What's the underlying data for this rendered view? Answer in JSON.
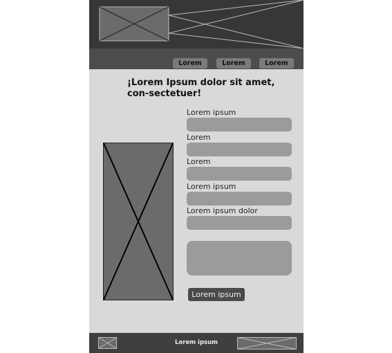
{
  "header": {
    "logo_icon": "image-placeholder-icon",
    "banner_icon": "image-placeholder-icon"
  },
  "nav": {
    "items": [
      {
        "label": "Lorem"
      },
      {
        "label": "Lorem"
      },
      {
        "label": "Lorem"
      }
    ]
  },
  "main": {
    "title": "¡Lorem Ipsum dolor sit amet, con-sectetuer!",
    "image_icon": "image-placeholder-icon",
    "form": {
      "fields": [
        {
          "label": "Lorem ipsum",
          "value": ""
        },
        {
          "label": "Lorem",
          "value": ""
        },
        {
          "label": "Lorem",
          "value": ""
        },
        {
          "label": "Lorem ipsum",
          "value": ""
        },
        {
          "label": "Lorem ipsum dolor",
          "value": ""
        }
      ],
      "message": "",
      "submit_label": "Lorem ipsum"
    }
  },
  "footer": {
    "text": "Lorem ipsum",
    "left_icon": "image-placeholder-icon",
    "right_icon": "image-placeholder-icon"
  },
  "colors": {
    "page_background": "#d9d9d9",
    "header": "#373737",
    "nav": "#4c4c4c",
    "nav_button": "#7a7a7a",
    "field": "#9b9b9b",
    "submit_button": "#4a4a4a",
    "footer": "#3f3f3f",
    "placeholder_fill": "#6b6b6b"
  }
}
